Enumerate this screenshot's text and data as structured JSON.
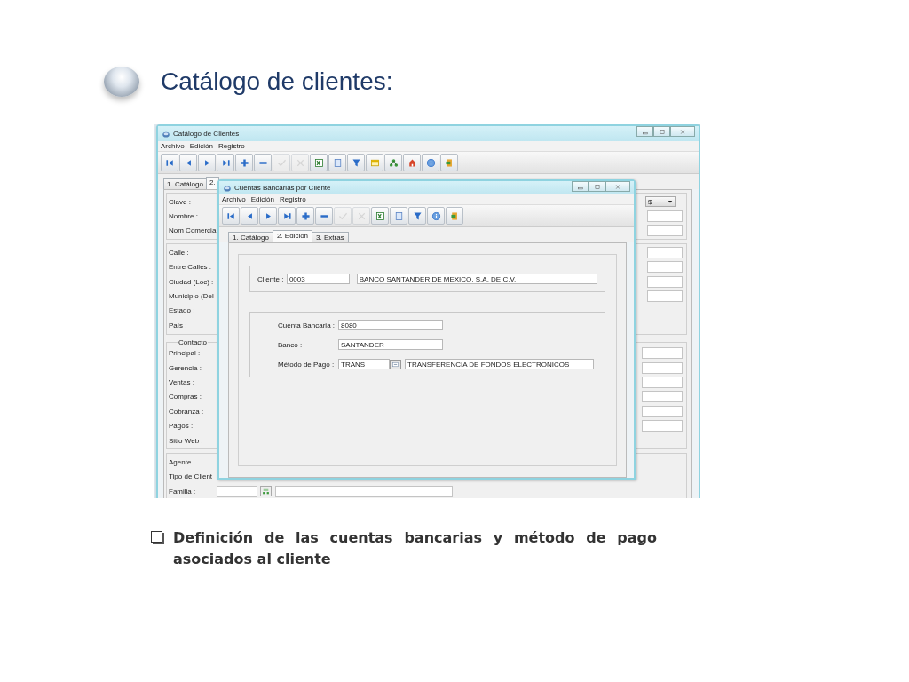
{
  "slide": {
    "title": "Catálogo de clientes:",
    "bullet": "Definición de las cuentas bancarias y método de pago asociados al cliente"
  },
  "back_window": {
    "title": "Catálogo de Clientes",
    "menu": [
      "Archivo",
      "Edición",
      "Registro"
    ],
    "toolbar": [
      {
        "kind": "first",
        "disabled": false
      },
      {
        "kind": "prev",
        "disabled": false
      },
      {
        "kind": "next",
        "disabled": false
      },
      {
        "kind": "last",
        "disabled": false
      },
      {
        "kind": "add",
        "disabled": false
      },
      {
        "kind": "remove",
        "disabled": false
      },
      {
        "kind": "confirm",
        "disabled": true
      },
      {
        "kind": "cancel",
        "disabled": true
      },
      {
        "kind": "excel",
        "disabled": false
      },
      {
        "kind": "page",
        "disabled": false
      },
      {
        "kind": "filter",
        "disabled": false
      },
      {
        "kind": "form",
        "disabled": false
      },
      {
        "kind": "tree",
        "disabled": false
      },
      {
        "kind": "home",
        "disabled": false
      },
      {
        "kind": "info",
        "disabled": false
      },
      {
        "kind": "exit",
        "disabled": false
      }
    ],
    "tabs": [
      {
        "label": "1. Catálogo",
        "selected": false
      },
      {
        "label": "2.",
        "selected": true
      }
    ],
    "sections": [
      {
        "rows": [
          {
            "label": "Clave :",
            "kind": "dropdown",
            "value": "$"
          },
          {
            "label": "Nombre :",
            "kind": "text"
          },
          {
            "label": "Nom Comercia",
            "kind": "text"
          }
        ]
      },
      {
        "rows": [
          {
            "label": "Calle :",
            "kind": "text"
          },
          {
            "label": "Entre Calles :",
            "kind": "text"
          },
          {
            "label": "Ciudad (Loc) :",
            "kind": "text"
          },
          {
            "label": "Municipio (Del",
            "kind": "text"
          },
          {
            "label": "Estado :",
            "kind": "none"
          },
          {
            "label": "País :",
            "kind": "none"
          }
        ]
      },
      {
        "legend": "Contacto",
        "rows": [
          {
            "label": "Principal :",
            "kind": "text"
          },
          {
            "label": "Gerencia :",
            "kind": "text"
          },
          {
            "label": "Ventas :",
            "kind": "text"
          },
          {
            "label": "Compras :",
            "kind": "text"
          },
          {
            "label": "Cobranza :",
            "kind": "text"
          },
          {
            "label": "Pagos :",
            "kind": "text"
          },
          {
            "label": "Sitio Web :",
            "kind": "none"
          }
        ]
      },
      {
        "rows": [
          {
            "label": "Agente :",
            "kind": "none"
          },
          {
            "label": "Tipo de Client",
            "kind": "none"
          },
          {
            "label": "Familia :",
            "kind": "lookup"
          }
        ]
      }
    ]
  },
  "front_window": {
    "title": "Cuentas Bancarias por Cliente",
    "menu": [
      "Archivo",
      "Edición",
      "Registro"
    ],
    "toolbar": [
      {
        "kind": "first",
        "disabled": false
      },
      {
        "kind": "prev",
        "disabled": false
      },
      {
        "kind": "next",
        "disabled": false
      },
      {
        "kind": "last",
        "disabled": false
      },
      {
        "kind": "add",
        "disabled": false
      },
      {
        "kind": "remove",
        "disabled": false
      },
      {
        "kind": "confirm",
        "disabled": true
      },
      {
        "kind": "cancel",
        "disabled": true
      },
      {
        "kind": "excel",
        "disabled": false
      },
      {
        "kind": "page",
        "disabled": false
      },
      {
        "kind": "filter",
        "disabled": false
      },
      {
        "kind": "info",
        "disabled": false
      },
      {
        "kind": "exit",
        "disabled": false
      }
    ],
    "tabs": [
      {
        "label": "1. Catálogo",
        "selected": false
      },
      {
        "label": "2. Edición",
        "selected": true
      },
      {
        "label": "3. Extras",
        "selected": false
      }
    ],
    "client": {
      "label": "Cliente :",
      "code": "0003",
      "name": "BANCO SANTANDER DE MEXICO, S.A. DE C.V."
    },
    "account": {
      "label": "Cuenta Bancaria :",
      "value": "8080"
    },
    "bank": {
      "label": "Banco :",
      "value": "SANTANDER"
    },
    "method": {
      "label": "Método de Pago :",
      "code": "TRANS",
      "name": "TRANSFERENCIA DE FONDOS ELECTRONICOS"
    }
  }
}
